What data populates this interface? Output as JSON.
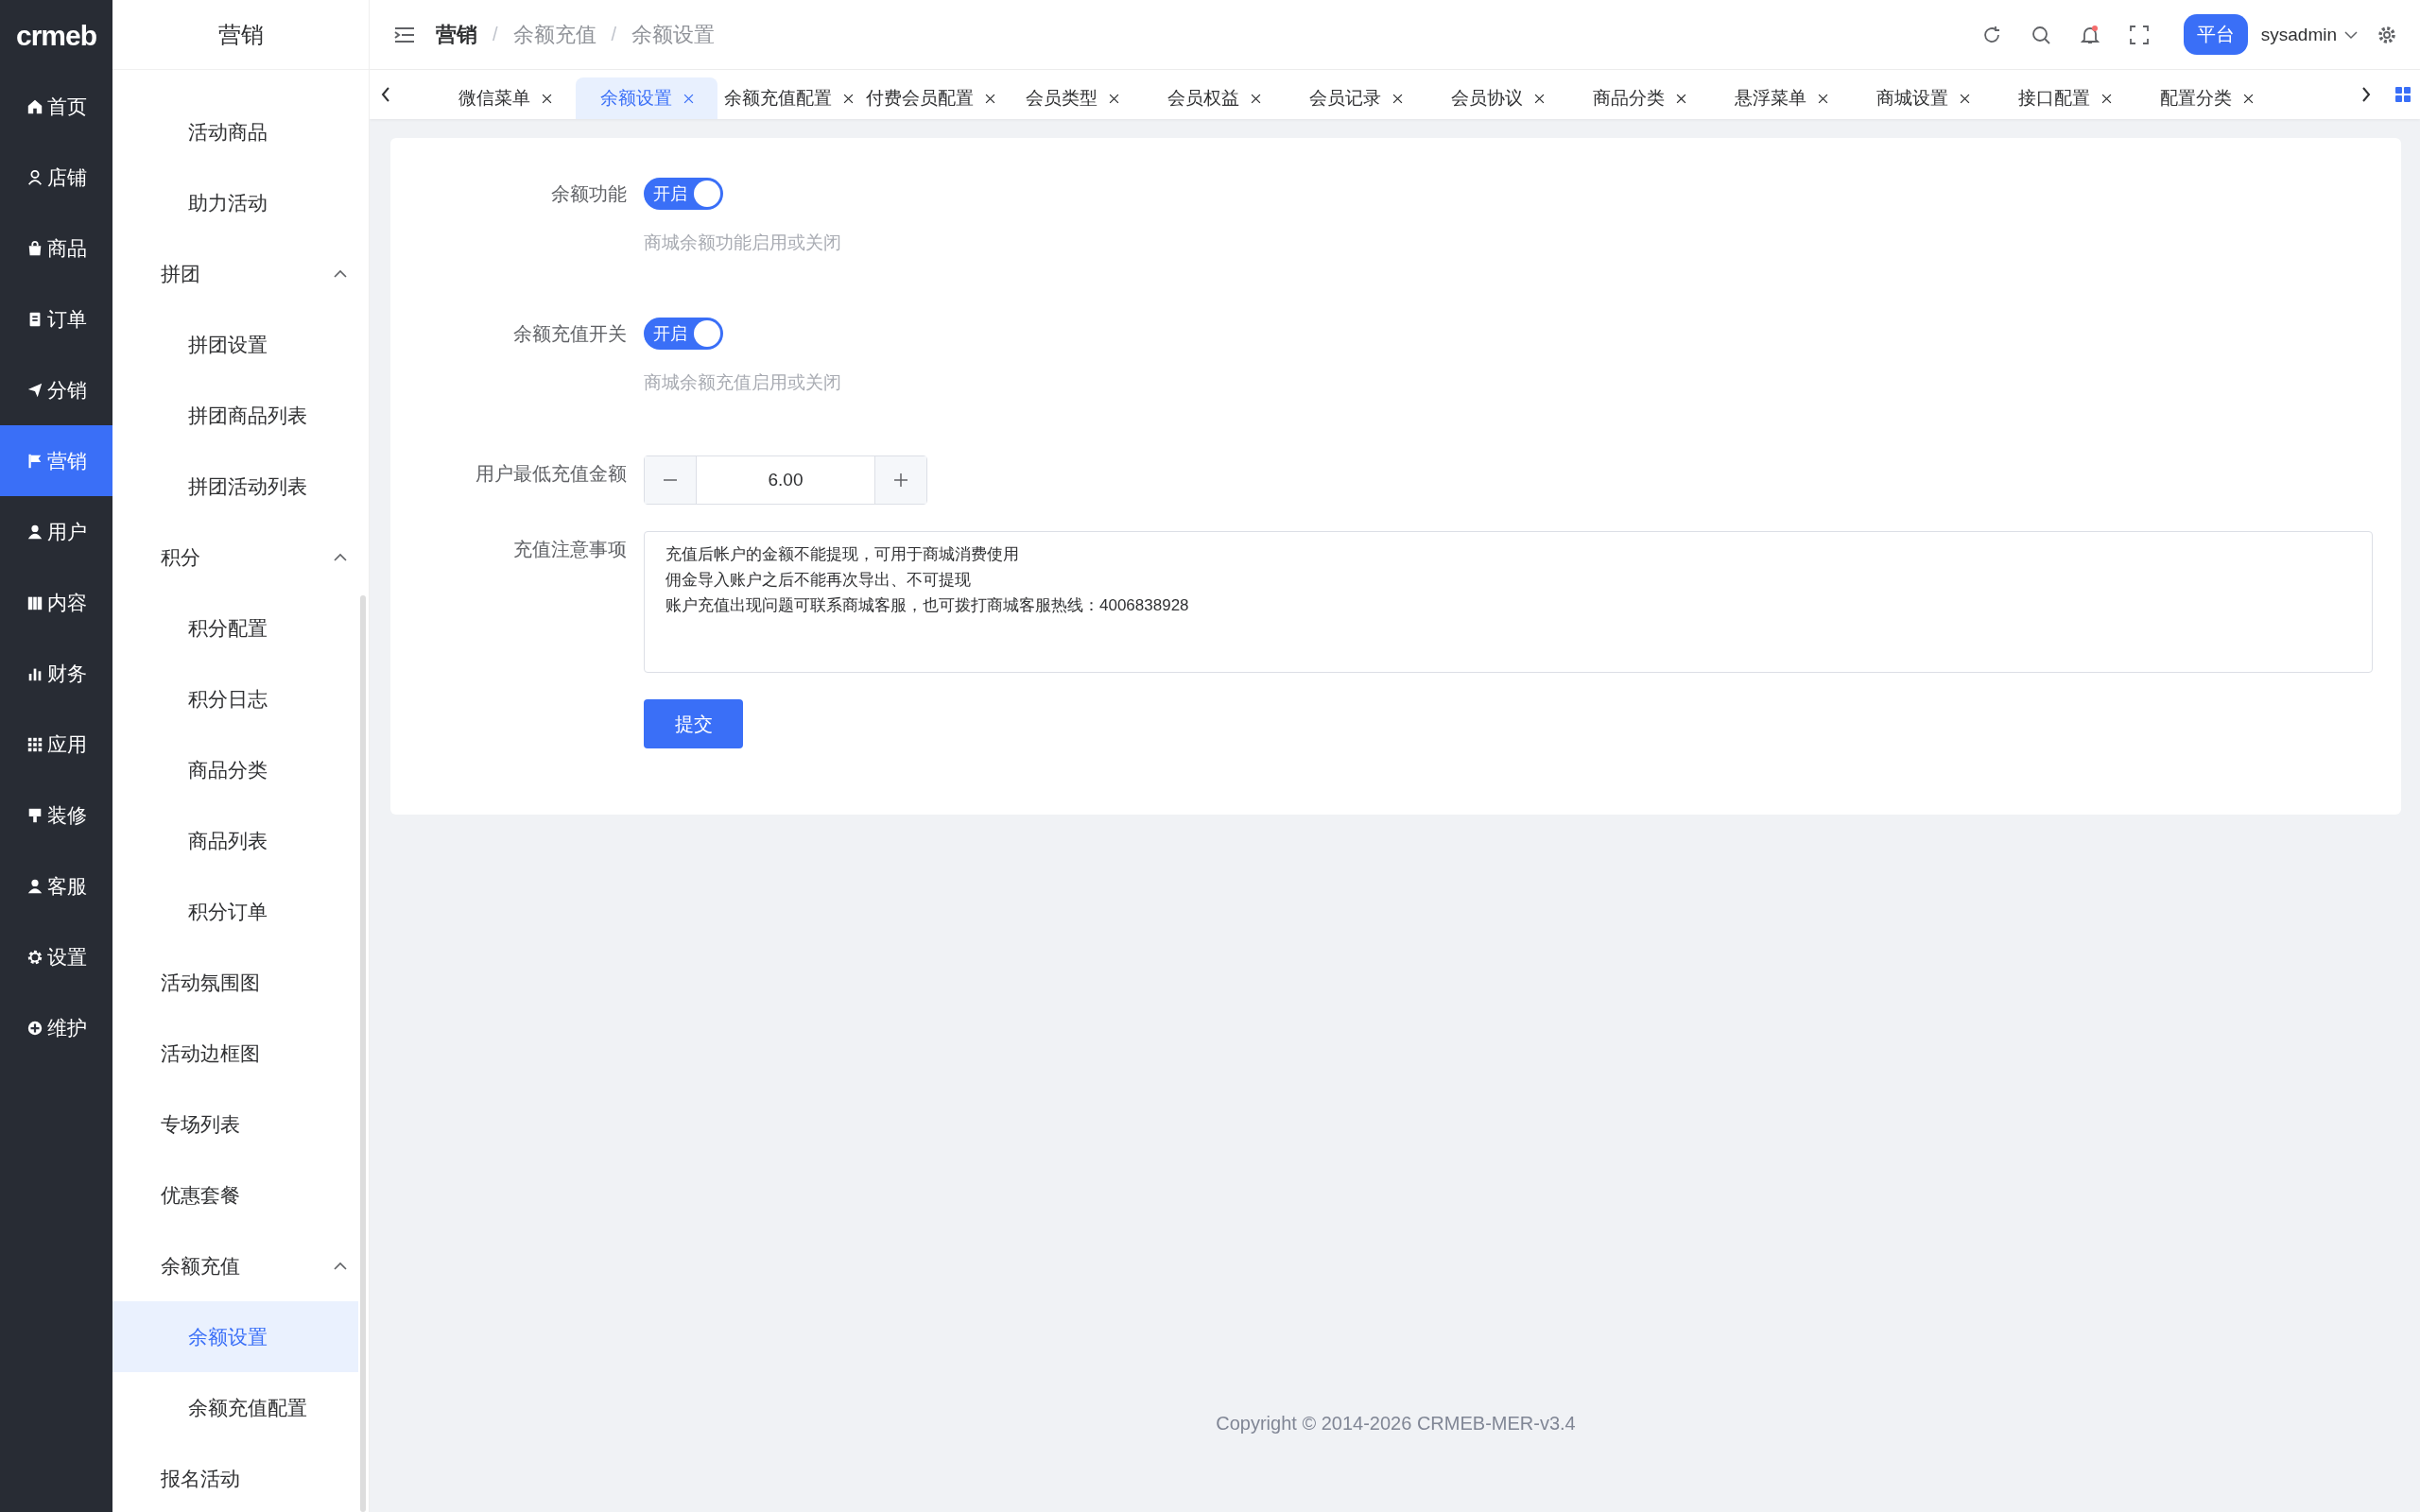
{
  "logo": "crmeb",
  "rail": [
    {
      "label": "首页",
      "selected": false
    },
    {
      "label": "店铺",
      "selected": false
    },
    {
      "label": "商品",
      "selected": false
    },
    {
      "label": "订单",
      "selected": false
    },
    {
      "label": "分销",
      "selected": false
    },
    {
      "label": "营销",
      "selected": true
    },
    {
      "label": "用户",
      "selected": false
    },
    {
      "label": "内容",
      "selected": false
    },
    {
      "label": "财务",
      "selected": false
    },
    {
      "label": "应用",
      "selected": false
    },
    {
      "label": "装修",
      "selected": false
    },
    {
      "label": "客服",
      "selected": false
    },
    {
      "label": "设置",
      "selected": false
    },
    {
      "label": "维护",
      "selected": false
    }
  ],
  "sidebar": {
    "title": "营销",
    "items": [
      {
        "children": [
          {
            "label": "活动商品",
            "selected": false
          },
          {
            "label": "助力活动",
            "selected": false
          }
        ]
      },
      {
        "label": "拼团",
        "expanded": true,
        "children": [
          {
            "label": "拼团设置",
            "selected": false
          },
          {
            "label": "拼团商品列表",
            "selected": false
          },
          {
            "label": "拼团活动列表",
            "selected": false
          }
        ]
      },
      {
        "label": "积分",
        "expanded": true,
        "children": [
          {
            "label": "积分配置",
            "selected": false
          },
          {
            "label": "积分日志",
            "selected": false
          },
          {
            "label": "商品分类",
            "selected": false
          },
          {
            "label": "商品列表",
            "selected": false
          },
          {
            "label": "积分订单",
            "selected": false
          }
        ]
      },
      {
        "label": "活动氛围图",
        "selected": false
      },
      {
        "label": "活动边框图",
        "selected": false
      },
      {
        "label": "专场列表",
        "selected": false
      },
      {
        "label": "优惠套餐",
        "selected": false
      },
      {
        "label": "余额充值",
        "expanded": true,
        "children": [
          {
            "label": "余额设置",
            "selected": true
          },
          {
            "label": "余额充值配置",
            "selected": false
          }
        ]
      },
      {
        "label": "报名活动",
        "selected": false
      }
    ]
  },
  "header": {
    "breadcrumb": [
      "营销",
      "余额充值",
      "余额设置"
    ],
    "breadcrumb_separator": "/",
    "platform_button": "平台",
    "user": "sysadmin"
  },
  "tabs": [
    {
      "label": "微信菜单",
      "selected": false
    },
    {
      "label": "余额设置",
      "selected": true
    },
    {
      "label": "余额充值配置",
      "selected": false
    },
    {
      "label": "付费会员配置",
      "selected": false
    },
    {
      "label": "会员类型",
      "selected": false
    },
    {
      "label": "会员权益",
      "selected": false
    },
    {
      "label": "会员记录",
      "selected": false
    },
    {
      "label": "会员协议",
      "selected": false
    },
    {
      "label": "商品分类",
      "selected": false
    },
    {
      "label": "悬浮菜单",
      "selected": false
    },
    {
      "label": "商城设置",
      "selected": false
    },
    {
      "label": "接口配置",
      "selected": false
    },
    {
      "label": "配置分类",
      "selected": false
    }
  ],
  "form": {
    "fields": [
      {
        "kind": "switch",
        "label": "余额功能",
        "on": true,
        "switch_text": "开启",
        "hint": "商城余额功能启用或关闭"
      },
      {
        "kind": "switch",
        "label": "余额充值开关",
        "on": true,
        "switch_text": "开启",
        "hint": "商城余额充值启用或关闭"
      },
      {
        "kind": "number",
        "label": "用户最低充值金额",
        "value": "6.00"
      },
      {
        "kind": "textarea",
        "label": "充值注意事项",
        "lines": [
          "充值后帐户的金额不能提现，可用于商城消费使用",
          "佣金导入账户之后不能再次导出、不可提现",
          "账户充值出现问题可联系商城客服，也可拨打商城客服热线：4006838928"
        ]
      }
    ],
    "submit": "提交"
  },
  "footer": "Copyright © 2014-2026 CRMEB-MER-v3.4"
}
